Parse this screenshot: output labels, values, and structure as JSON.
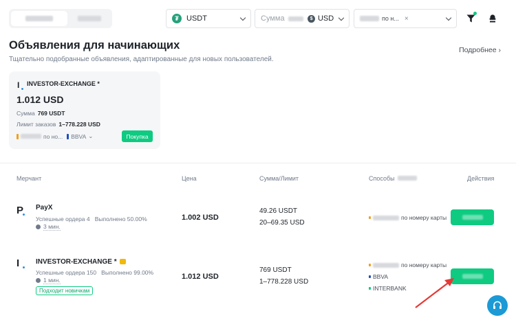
{
  "filters": {
    "coin": "USDT",
    "coin_glyph": "₮",
    "amount_placeholder": "Сумма",
    "fiat": "USD",
    "fiat_glyph": "$",
    "payment_partial": "по н...",
    "clear": "×"
  },
  "section": {
    "title": "Объявления для начинающих",
    "subtitle": "Тщательно подобранные объявления, адаптированные для новых пользователей.",
    "more": "Подробнее ›"
  },
  "featured": {
    "initial": "I",
    "merchant": "INVESTOR-EXCHANGE *",
    "price": "1.012 USD",
    "amount_label": "Сумма",
    "amount_value": "769 USDT",
    "limit_label": "Лимит заказов",
    "limit_value": "1–778.228 USD",
    "payment_partial": "по но...",
    "payment_bbva": "BBVA",
    "more_glyph": "⌄",
    "buy_label": "Покупка"
  },
  "table": {
    "headers": {
      "merchant": "Мерчант",
      "price": "Цена",
      "amount_limit": "Сумма/Лимит",
      "methods": "Способы",
      "actions": "Действия"
    },
    "rows": [
      {
        "initial": "P",
        "name": "PayX",
        "orders": "Успешные ордера 4",
        "completed": "Выполнено 50.00%",
        "time": "3 мин.",
        "price": "1.002 USD",
        "amount": "49.26 USDT",
        "limit": "20–69.35 USD",
        "methods": [
          "по номеру карты"
        ]
      },
      {
        "initial": "I",
        "name": "INVESTOR-EXCHANGE *",
        "orders": "Успешные ордера 150",
        "completed": "Выполнено 99.00%",
        "time": "1 мин.",
        "badge": "Подходит новичкам",
        "price": "1.012 USD",
        "amount": "769 USDT",
        "limit": "1–778.228 USD",
        "methods": [
          "по номеру карты",
          "BBVA",
          "INTERBANK"
        ]
      }
    ]
  },
  "colors": {
    "accent": "#0ecb81",
    "annotation_arrow": "#e53935",
    "support": "#1c9ad6",
    "bank_dot_orange": "#f0a020",
    "bank_dot_blue": "#1f4fbf",
    "bank_dot_green": "#0ecb81"
  }
}
